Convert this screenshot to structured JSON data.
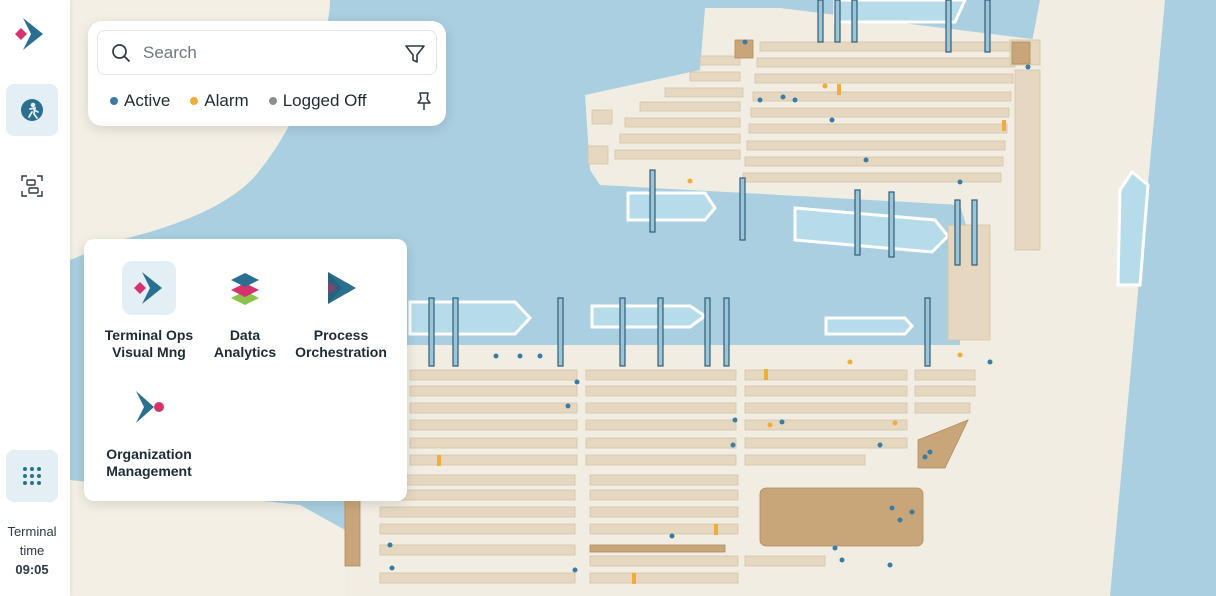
{
  "search": {
    "placeholder": "Search"
  },
  "legend": [
    {
      "label": "Active",
      "color": "#3a7ca3"
    },
    {
      "label": "Alarm",
      "color": "#f0ad3a"
    },
    {
      "label": "Logged Off",
      "color": "#8a8f94"
    }
  ],
  "apps": [
    {
      "line1": "Terminal Ops",
      "line2": "Visual Mng"
    },
    {
      "line1": "Data",
      "line2": "Analytics"
    },
    {
      "line1": "Process",
      "line2": "Orchestration"
    },
    {
      "line1": "Organization",
      "line2": "Management"
    }
  ],
  "terminal_time": {
    "line1": "Terminal",
    "line2": "time",
    "value": "09:05"
  },
  "colors": {
    "accent": "#3a7ca3",
    "brand_pink": "#d6336c",
    "brand_blue": "#2a6f8f",
    "sea": "#a9cfe0",
    "land": "#f1ede3",
    "yard": "#e6d8c0"
  }
}
